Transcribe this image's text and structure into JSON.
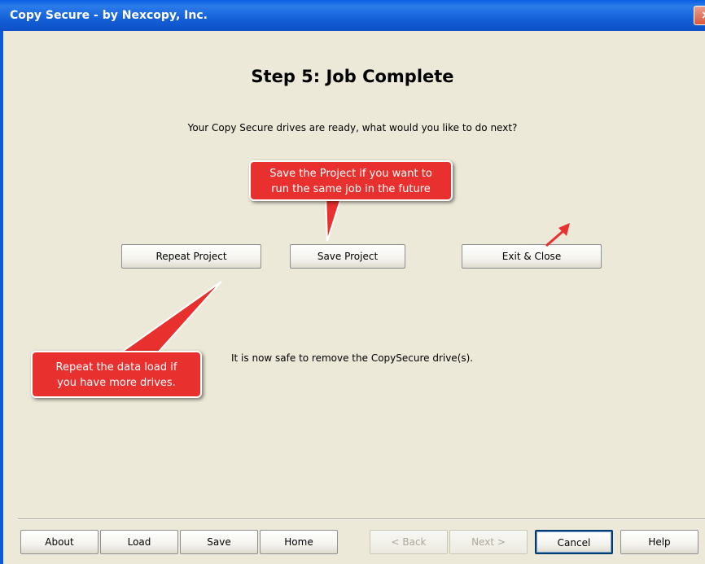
{
  "window": {
    "title": "Copy Secure - by Nexcopy, Inc."
  },
  "main": {
    "heading": "Step 5: Job Complete",
    "prompt": "Your Copy Secure drives are ready, what would you like to do next?",
    "safe_message": "It is now safe to remove the CopySecure drive(s)."
  },
  "actions": {
    "repeat": "Repeat Project",
    "save": "Save Project",
    "exit": "Exit & Close"
  },
  "callouts": {
    "save_line1": "Save the Project if you want to",
    "save_line2": "run the same job in the future",
    "repeat_line1": "Repeat the data load if",
    "repeat_line2": "you have more drives."
  },
  "nav": {
    "about": "About",
    "load": "Load",
    "save": "Save",
    "home": "Home",
    "back": "< Back",
    "next": "Next >",
    "cancel": "Cancel",
    "help": "Help"
  },
  "colors": {
    "callout": "#E8302E",
    "titlebar": "#0A5FE0",
    "window_bg": "#ECE9D8"
  }
}
